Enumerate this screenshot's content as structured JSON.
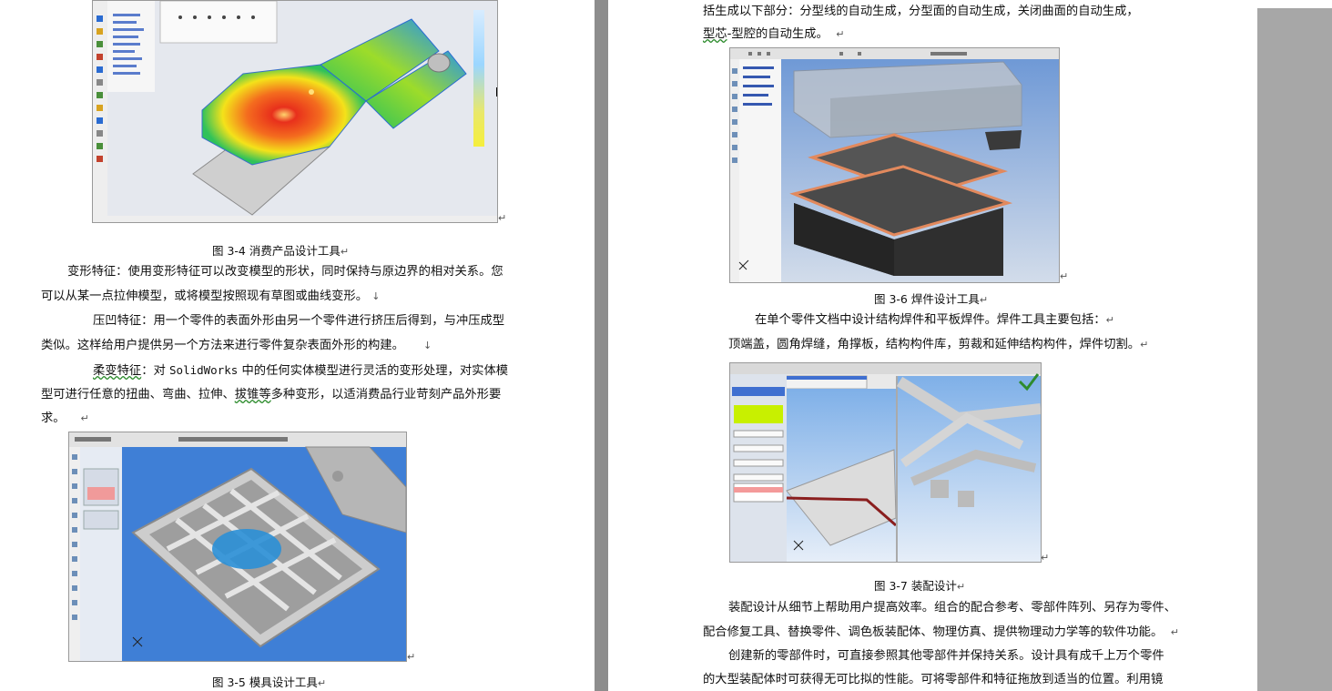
{
  "left_page": {
    "caption_3_4": "图 3-4  消费产品设计工具",
    "para_deform": {
      "label": "变形特征：",
      "line1": "使用变形特征可以改变模型的形状，同时保持与原边界的相对关系。您",
      "line2": "可以从某一点拉伸模型，或将模型按照现有草图或曲线变形。"
    },
    "para_indent": {
      "label": "压凹特征：",
      "line1": "用一个零件的表面外形由另一个零件进行挤压后得到，与冲压成型",
      "line2": "类似。这样给用户提供另一个方法来进行零件复杂表面外形的构建。"
    },
    "para_flex": {
      "label": "柔变特征",
      "line1_a": "：对 ",
      "line1_b": "SolidWorks",
      "line1_c": " 中的任何实体模型进行灵活的变形处理，对实体模",
      "line2_a": "型可进行任意的扭曲、弯曲、拉伸、",
      "line2_b": "拔锥等",
      "line2_c": "多种变形，以适消费品行业苛刻产品外形要",
      "line3": "求。"
    },
    "caption_3_5": "图 3-5  模具设计工具"
  },
  "right_page": {
    "top_line1": "括生成以下部分：分型线的自动生成，分型面的自动生成，关闭曲面的自动生成，",
    "top_line2_a": "型芯",
    "top_line2_b": "-型腔的自动生成。",
    "caption_3_6": "图 3-6  焊件设计工具",
    "para_weld_line1": "在单个零件文档中设计结构焊件和平板焊件。焊件工具主要包括：",
    "para_weld_line2": "顶端盖，圆角焊缝，角撑板，结构构件库，剪裁和延伸结构构件，焊件切割。",
    "caption_3_7": "图 3-7  装配设计",
    "para_asm_line1": "装配设计从细节上帮助用户提高效率。组合的配合参考、零部件阵列、另存为零件、",
    "para_asm_line2": "配合修复工具、替换零件、调色板装配体、物理仿真、提供物理动力学等的软件功能。",
    "para_new_line1": "创建新的零部件时，可直接参照其他零部件并保持关系。设计具有成千上万个零件",
    "para_new_line2": "的大型装配体时可获得无可比拟的性能。可将零部件和特征拖放到适当的位置。利用镜"
  },
  "marks": {
    "para": "↵",
    "arrow": "↓"
  },
  "colors": {
    "viewport_blue": "#3f7fd6",
    "heat_red": "#e8301c",
    "heat_yellow": "#f4e21a",
    "heat_green": "#2fc25a",
    "weld_orange": "#e2895d",
    "highlight_green": "#c8f000"
  }
}
